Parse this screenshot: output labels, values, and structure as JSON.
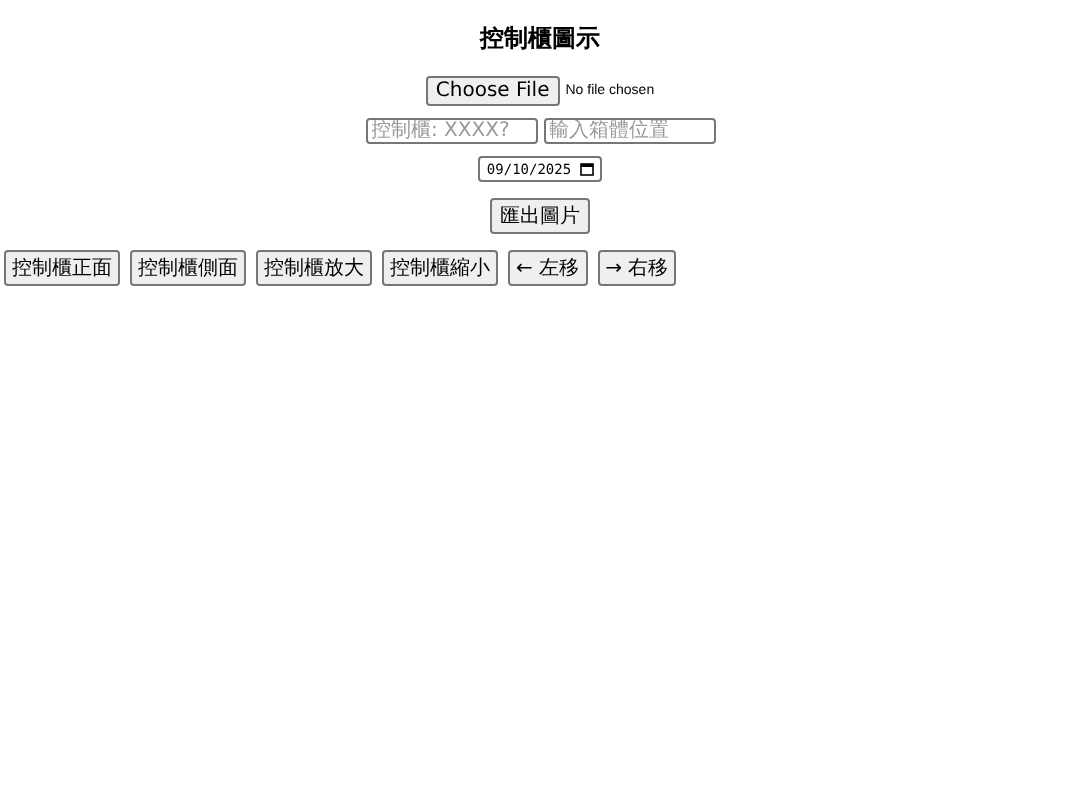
{
  "title": "控制櫃圖示",
  "file_picker": {
    "button": "Choose File",
    "status": "No file chosen"
  },
  "fields": [
    {
      "placeholder": "控制櫃: XXXX?"
    },
    {
      "placeholder": "輸入箱體位置"
    }
  ],
  "date_field": {
    "value": "09/10/2025"
  },
  "export_button": "匯出圖片",
  "toolbar": [
    "控制櫃正面",
    "控制櫃側面",
    "控制櫃放大",
    "控制櫃縮小",
    "← 左移",
    "→ 右移"
  ]
}
